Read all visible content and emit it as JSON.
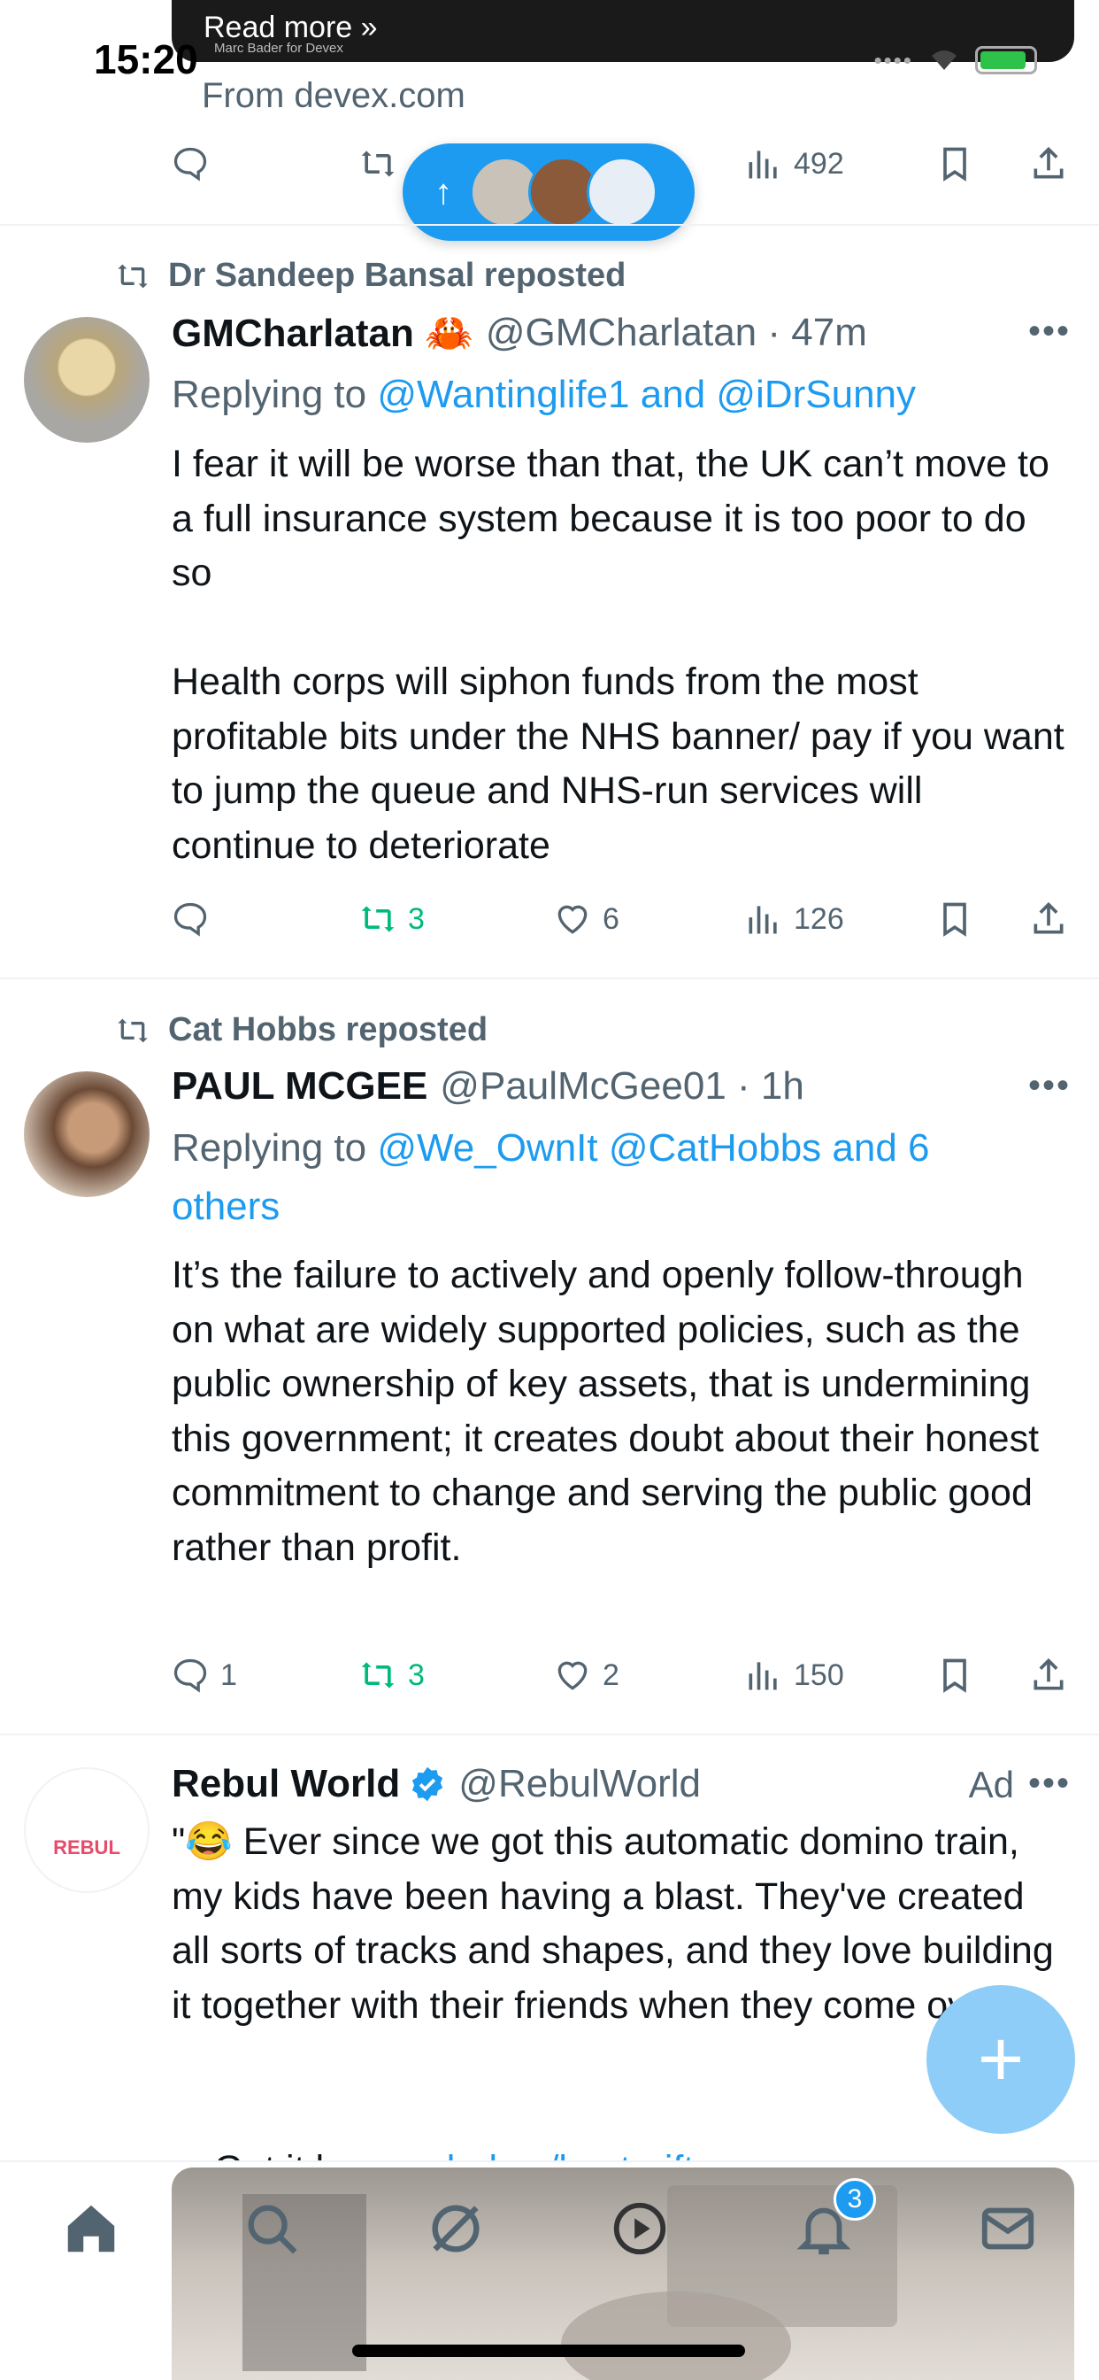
{
  "status_bar": {
    "time": "15:20",
    "signal": "••••"
  },
  "top_media": {
    "read_more": "Read more »",
    "credit": "Marc Bader for Devex"
  },
  "prev_tweet": {
    "from_link": "From devex.com",
    "views": "492"
  },
  "new_posts_pill": {
    "arrow": "↑",
    "accent": "#1d9bf0"
  },
  "tweets": [
    {
      "repost_by": "Dr Sandeep Bansal reposted",
      "name": "GMCharlatan 🦀",
      "handle": "@GMCharlatan · 47m",
      "reply_prefix": "Replying to ",
      "reply_mentions": "@Wantinglife1 and @iDrSunny",
      "body": "I fear it will be worse than that, the UK can’t move to a full insurance system because it is too poor to do so\n\nHealth corps will siphon funds from the most profitable bits under the NHS banner/ pay if you want to jump the queue and NHS-run services will continue to deteriorate",
      "replies": "",
      "reposts": "3",
      "likes": "6",
      "views": "126"
    },
    {
      "repost_by": "Cat Hobbs reposted",
      "name": "PAUL MCGEE",
      "handle": "@PaulMcGee01 · 1h",
      "reply_prefix": "Replying to ",
      "reply_mentions": "@We_OwnIt @CatHobbs and 6 others",
      "body": "It’s the failure to actively and openly follow-through on what are widely supported policies, such as the public ownership of key assets, that is undermining this government; it creates doubt about their honest commitment to change and serving the public good rather than profit.",
      "replies": "1",
      "reposts": "3",
      "likes": "2",
      "views": "150"
    },
    {
      "name": "Rebul World",
      "handle": "@RebulWorld",
      "ad_label": "Ad",
      "body": "\"😂 Ever since we got this automatic domino train, my kids have been having a blast. They've created all sorts of tracks and shapes, and they love building it together with their friends when they come over!\"",
      "cta_prefix": "Get it here: ",
      "cta_link": "rebul.co/best-gift",
      "avatar_text": "REBUL"
    }
  ],
  "fab": {
    "label": "+"
  },
  "bottom_nav": {
    "items": [
      "home-icon",
      "search-icon",
      "grok-icon",
      "video-icon",
      "notifications-icon",
      "messages-icon"
    ],
    "notification_count": "3"
  },
  "colors": {
    "accent": "#1d9bf0",
    "repost_green": "#00ba7c",
    "muted": "#536471"
  }
}
